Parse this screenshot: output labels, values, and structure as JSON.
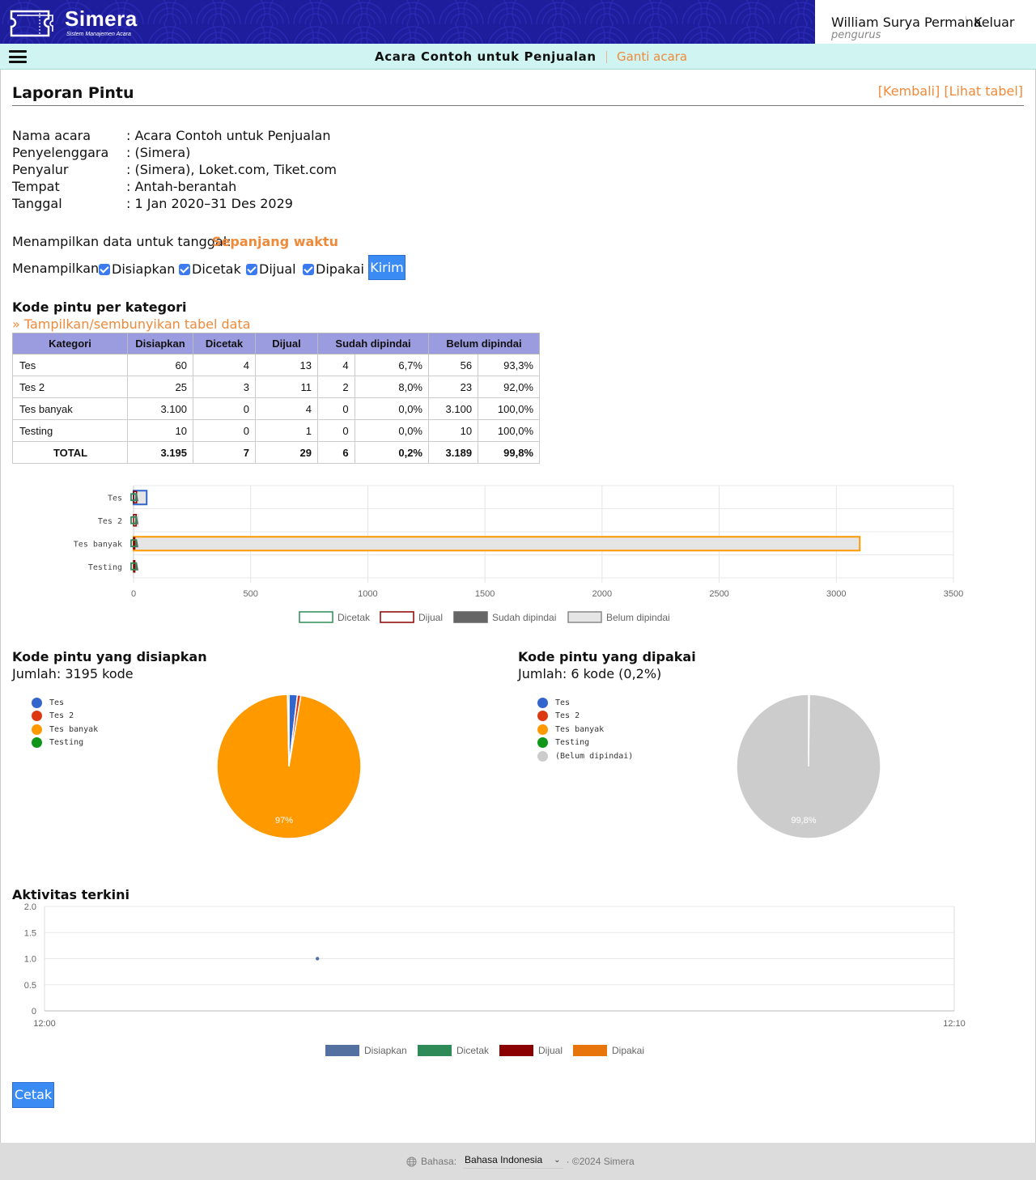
{
  "header": {
    "logo_name": "Simera",
    "logo_tagline": "Sistem Manajemen Acara",
    "user_name": "William Surya Permana",
    "user_role": "pengurus",
    "logout_label": "Keluar"
  },
  "eventbar": {
    "event_title": "Acara Contoh untuk Penjualan",
    "change_label": "Ganti acara"
  },
  "page": {
    "title": "Laporan Pintu",
    "back_link": "[Kembali]",
    "table_link": "[Lihat tabel]"
  },
  "info": [
    {
      "key": "Nama acara",
      "value": ": Acara Contoh untuk Penjualan"
    },
    {
      "key": "Penyelenggara",
      "value": ": (Simera)"
    },
    {
      "key": "Penyalur",
      "value": ": (Simera), Loket.com, Tiket.com"
    },
    {
      "key": "Tempat",
      "value": ": Antah-berantah"
    },
    {
      "key": "Tanggal",
      "value": ": 1 Jan 2020–31 Des 2029"
    }
  ],
  "filters": {
    "date_label": "Menampilkan data untuk tanggal:",
    "date_value": "Sepanjang waktu",
    "show_label": "Menampilkan:",
    "checkboxes": [
      {
        "label": "Disiapkan",
        "checked": true
      },
      {
        "label": "Dicetak",
        "checked": true
      },
      {
        "label": "Dijual",
        "checked": true
      },
      {
        "label": "Dipakai",
        "checked": true
      }
    ],
    "submit_label": "Kirim"
  },
  "section_categories": {
    "title": "Kode pintu per kategori",
    "toggle_label": "» Tampilkan/sembunyikan tabel data",
    "columns": [
      "Kategori",
      "Disiapkan",
      "Dicetak",
      "Dijual",
      "Sudah dipindai",
      "Belum dipindai"
    ],
    "rows": [
      [
        "Tes",
        "60",
        "4",
        "13",
        "4",
        "6,7%",
        "56",
        "93,3%"
      ],
      [
        "Tes 2",
        "25",
        "3",
        "11",
        "2",
        "8,0%",
        "23",
        "92,0%"
      ],
      [
        "Tes banyak",
        "3.100",
        "0",
        "4",
        "0",
        "0,0%",
        "3.100",
        "100,0%"
      ],
      [
        "Testing",
        "10",
        "0",
        "1",
        "0",
        "0,0%",
        "10",
        "100,0%"
      ],
      [
        "TOTAL",
        "3.195",
        "7",
        "29",
        "6",
        "0,2%",
        "3.189",
        "99,8%"
      ]
    ]
  },
  "section_prepared": {
    "title": "Kode pintu yang disiapkan",
    "count": "Jumlah: 3195 kode"
  },
  "section_used": {
    "title": "Kode pintu yang dipakai",
    "count": "Jumlah: 6 kode (0,2%)"
  },
  "section_activity": {
    "title": "Aktivitas terkini"
  },
  "print_label": "Cetak",
  "footer": {
    "language_label": "Bahasa:",
    "language_value": "Bahasa Indonesia",
    "copyright": "· ©2024 Simera"
  },
  "colors": {
    "accent": "#ef8a3a",
    "button": "#3b8bf5",
    "banner": "#1f1f9a",
    "eventbar": "#d0f4f2",
    "table_header": "#9b9be0"
  },
  "chart_data": [
    {
      "type": "bar",
      "orientation": "horizontal",
      "categories": [
        "Tes",
        "Tes 2",
        "Tes banyak",
        "Testing"
      ],
      "series": [
        {
          "name": "Dicetak",
          "values": [
            4,
            3,
            0,
            0
          ],
          "color": "#2e8b57",
          "style": "outline"
        },
        {
          "name": "Dijual",
          "values": [
            13,
            11,
            4,
            1
          ],
          "color": "#8b0000",
          "style": "outline"
        },
        {
          "name": "Sudah dipindai",
          "values": [
            4,
            2,
            0,
            0
          ],
          "color": "#666666",
          "style": "filled"
        },
        {
          "name": "Belum dipindai",
          "values": [
            56,
            23,
            3100,
            10
          ],
          "color": "#e5e5e5",
          "style": "filled"
        }
      ],
      "xlim": [
        0,
        3500
      ],
      "xticks": [
        "0",
        "500",
        "1000",
        "1500",
        "2000",
        "2500",
        "3000",
        "3500"
      ],
      "grid": true,
      "legend_position": "bottom"
    },
    {
      "type": "pie",
      "labels": [
        "Tes",
        "Tes 2",
        "Tes banyak",
        "Testing"
      ],
      "values": [
        60,
        25,
        3100,
        10
      ],
      "colors": [
        "#3366cc",
        "#dc3912",
        "#ff9900",
        "#109618"
      ],
      "data_labels": [
        "",
        "",
        "97%",
        ""
      ],
      "legend_position": "left"
    },
    {
      "type": "pie",
      "labels": [
        "Tes",
        "Tes 2",
        "Tes banyak",
        "Testing",
        "(Belum dipindai)"
      ],
      "values": [
        4,
        2,
        0,
        0,
        3189
      ],
      "colors": [
        "#3366cc",
        "#dc3912",
        "#ff9900",
        "#109618",
        "#cccccc"
      ],
      "data_labels": [
        "",
        "",
        "",
        "",
        "99,8%"
      ],
      "legend_position": "left"
    },
    {
      "type": "scatter",
      "x_range": [
        "12:00",
        "12:10"
      ],
      "xticks": [
        "12:00",
        "12:10"
      ],
      "ylim": [
        0,
        2
      ],
      "yticks": [
        "0",
        "0.5",
        "1.0",
        "1.5",
        "2.0"
      ],
      "series": [
        {
          "name": "Disiapkan",
          "color": "#5470a0",
          "points": [
            {
              "x": "12:03",
              "y": 1
            }
          ]
        },
        {
          "name": "Dicetak",
          "color": "#2e8b57",
          "points": []
        },
        {
          "name": "Dijual",
          "color": "#8b0000",
          "points": []
        },
        {
          "name": "Dipakai",
          "color": "#e8740c",
          "points": []
        }
      ],
      "grid": true,
      "legend_position": "bottom"
    }
  ]
}
